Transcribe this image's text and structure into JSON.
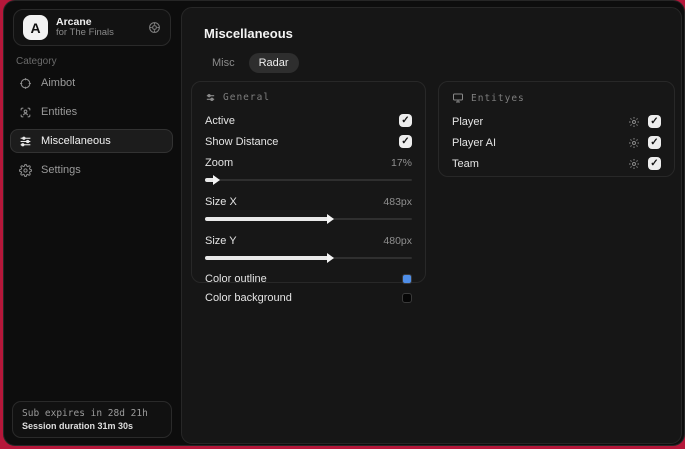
{
  "glyphs": {
    "check": "✓"
  },
  "colors": {
    "outer_red": "#b5173a",
    "outline_swatch": "#4f8ee8",
    "background_swatch": "#060606"
  },
  "sidebar": {
    "logo": {
      "initial": "A",
      "title": "Arcane",
      "subtitle": "for The Finals"
    },
    "category_label": "Category",
    "items": [
      {
        "label": "Aimbot"
      },
      {
        "label": "Entities"
      },
      {
        "label": "Miscellaneous"
      },
      {
        "label": "Settings"
      }
    ],
    "subscription": {
      "line1": "Sub expires in 28d 21h",
      "line2": "Session duration 31m 30s"
    }
  },
  "main": {
    "title": "Miscellaneous",
    "tabs": [
      {
        "label": "Misc"
      },
      {
        "label": "Radar"
      }
    ],
    "general_panel": {
      "title": "General",
      "checkbox_rows": [
        {
          "label": "Active",
          "checked": true
        },
        {
          "label": "Show Distance",
          "checked": true
        }
      ],
      "slider_rows": [
        {
          "label": "Zoom",
          "value": "17%",
          "percent": 5
        },
        {
          "label": "Size X",
          "value": "483px",
          "percent": 60
        },
        {
          "label": "Size Y",
          "value": "480px",
          "percent": 60
        }
      ],
      "color_rows": [
        {
          "label": "Color outline"
        },
        {
          "label": "Color background"
        }
      ]
    },
    "entities_panel": {
      "title": "Entityes",
      "rows": [
        {
          "label": "Player",
          "checked": true
        },
        {
          "label": "Player AI",
          "checked": true
        },
        {
          "label": "Team",
          "checked": true
        }
      ]
    }
  }
}
